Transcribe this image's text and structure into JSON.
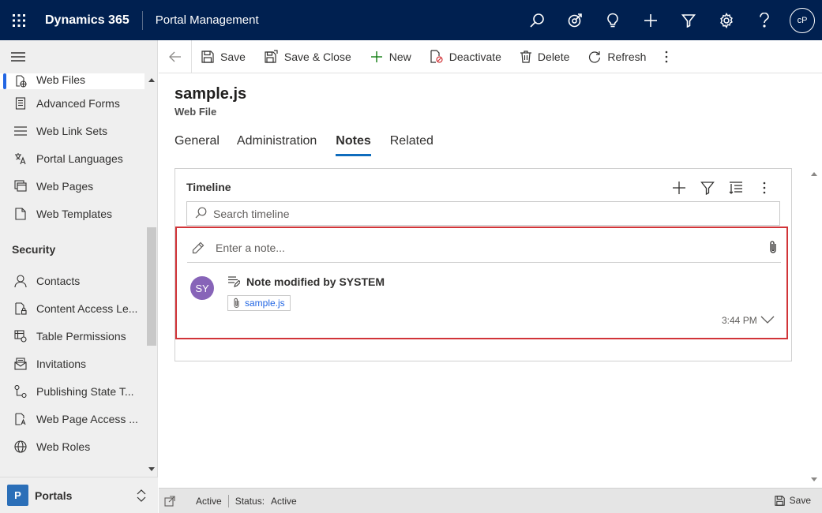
{
  "topbar": {
    "app_name": "Dynamics 365",
    "area_name": "Portal Management",
    "user_initials": "cP"
  },
  "sidebar": {
    "items_top": [
      {
        "label": "Web Files",
        "icon": "web-file-icon",
        "active": true
      },
      {
        "label": "Advanced Forms",
        "icon": "form-icon"
      },
      {
        "label": "Web Link Sets",
        "icon": "list-icon"
      },
      {
        "label": "Portal Languages",
        "icon": "language-icon"
      },
      {
        "label": "Web Pages",
        "icon": "pages-icon"
      },
      {
        "label": "Web Templates",
        "icon": "template-icon"
      }
    ],
    "section_security": "Security",
    "items_security": [
      {
        "label": "Contacts",
        "icon": "person-icon"
      },
      {
        "label": "Content Access Le...",
        "icon": "document-lock-icon"
      },
      {
        "label": "Table Permissions",
        "icon": "table-permission-icon"
      },
      {
        "label": "Invitations",
        "icon": "invitation-icon"
      },
      {
        "label": "Publishing State T...",
        "icon": "flow-icon"
      },
      {
        "label": "Web Page Access ...",
        "icon": "document-key-icon"
      },
      {
        "label": "Web Roles",
        "icon": "globe-icon"
      }
    ],
    "area": {
      "badge": "P",
      "label": "Portals"
    }
  },
  "commands": {
    "save": "Save",
    "save_close": "Save & Close",
    "new": "New",
    "deactivate": "Deactivate",
    "delete": "Delete",
    "refresh": "Refresh"
  },
  "record": {
    "title": "sample.js",
    "entity": "Web File"
  },
  "tabs": [
    "General",
    "Administration",
    "Notes",
    "Related"
  ],
  "selected_tab": "Notes",
  "timeline": {
    "title": "Timeline",
    "search_placeholder": "Search timeline",
    "note_placeholder": "Enter a note...",
    "entry": {
      "avatar": "SY",
      "title": "Note modified by SYSTEM",
      "attachment": "sample.js",
      "time": "3:44 PM"
    }
  },
  "footer": {
    "state": "Active",
    "status_label": "Status:",
    "status_value": "Active",
    "save": "Save"
  },
  "colors": {
    "topbar": "#002050",
    "accent": "#2266e3",
    "highlight": "#d13438",
    "avatar": "#8764b8",
    "area_badge": "#2b6fb8"
  }
}
